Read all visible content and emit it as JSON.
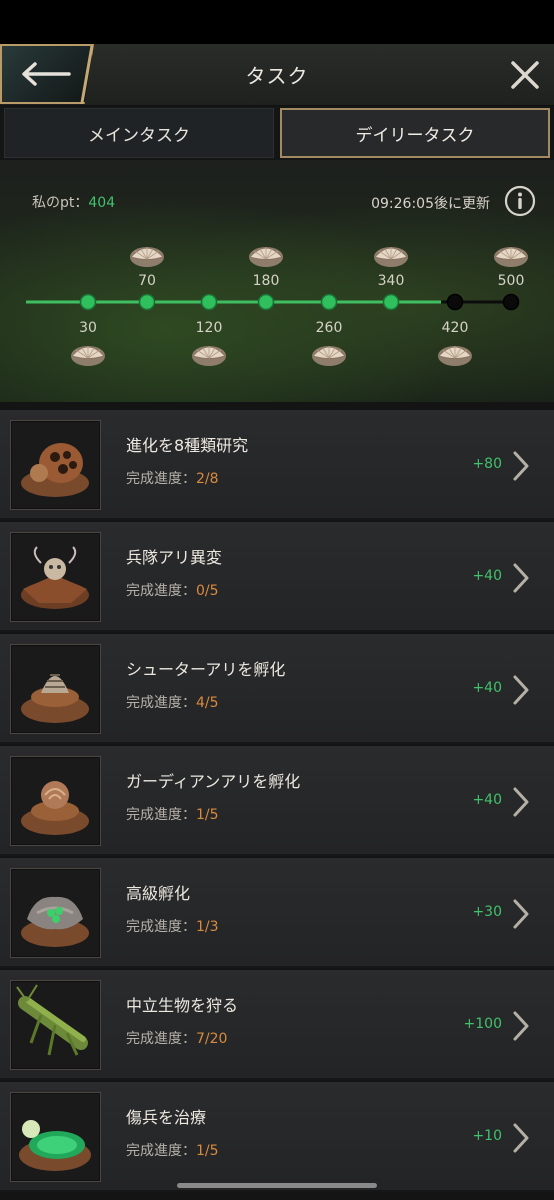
{
  "header": {
    "title": "タスク"
  },
  "tabs": [
    {
      "label": "メインタスク",
      "active": false
    },
    {
      "label": "デイリータスク",
      "active": true
    }
  ],
  "points": {
    "label": "私のpt：",
    "value": "404",
    "refresh_text": "09:26:05後に更新",
    "current": 404
  },
  "milestones": [
    {
      "value": "30",
      "position": "below",
      "reached": true
    },
    {
      "value": "70",
      "position": "above",
      "reached": true
    },
    {
      "value": "120",
      "position": "below",
      "reached": true
    },
    {
      "value": "180",
      "position": "above",
      "reached": true
    },
    {
      "value": "260",
      "position": "below",
      "reached": true
    },
    {
      "value": "340",
      "position": "above",
      "reached": true
    },
    {
      "value": "420",
      "position": "below",
      "reached": false
    },
    {
      "value": "500",
      "position": "above",
      "reached": false
    }
  ],
  "tasks": [
    {
      "name": "進化を8種類研究",
      "progress_label": "完成進度：",
      "progress": "2/8",
      "reward": "+80",
      "icon": "nest-egg-icon"
    },
    {
      "name": "兵隊アリ異変",
      "progress_label": "完成進度：",
      "progress": "0/5",
      "reward": "+40",
      "icon": "soldier-ant-icon"
    },
    {
      "name": "シューターアリを孵化",
      "progress_label": "完成進度：",
      "progress": "4/5",
      "reward": "+40",
      "icon": "shooter-ant-icon"
    },
    {
      "name": "ガーディアンアリを孵化",
      "progress_label": "完成進度：",
      "progress": "1/5",
      "reward": "+40",
      "icon": "guardian-ant-icon"
    },
    {
      "name": "高級孵化",
      "progress_label": "完成進度：",
      "progress": "1/3",
      "reward": "+30",
      "icon": "advanced-hatch-icon"
    },
    {
      "name": "中立生物を狩る",
      "progress_label": "完成進度：",
      "progress": "7/20",
      "reward": "+100",
      "icon": "grasshopper-icon"
    },
    {
      "name": "傷兵を治療",
      "progress_label": "完成進度：",
      "progress": "1/5",
      "reward": "+10",
      "icon": "healing-pool-icon"
    }
  ],
  "colors": {
    "accent_green": "#43c06b",
    "progress_orange": "#d98a3e",
    "gold_border": "#a48a60"
  }
}
